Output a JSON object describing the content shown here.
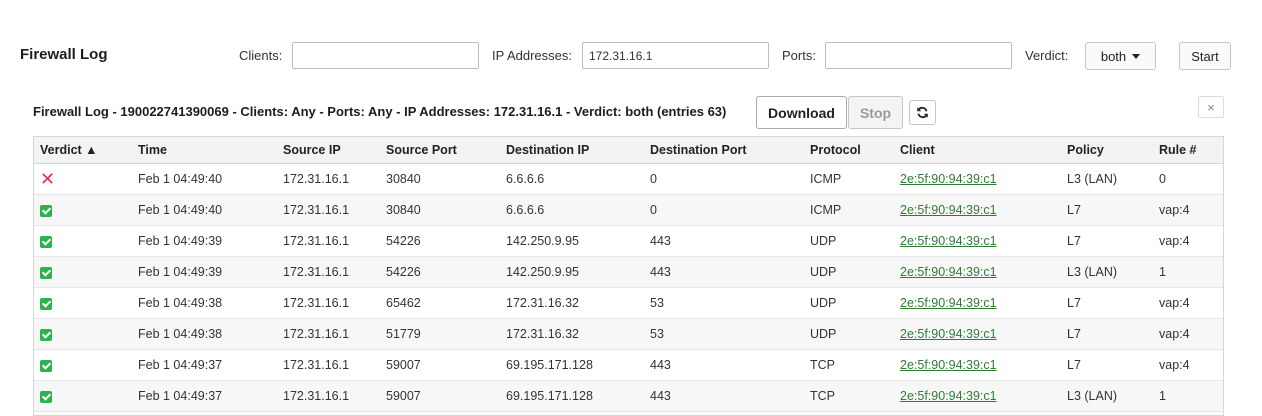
{
  "header": {
    "title": "Firewall Log"
  },
  "filters": {
    "clients_label": "Clients:",
    "clients_value": "",
    "ip_label": "IP Addresses:",
    "ip_value": "172.31.16.1",
    "ports_label": "Ports:",
    "ports_value": "",
    "verdict_label": "Verdict:",
    "verdict_value": "both",
    "start_label": "Start"
  },
  "toolbar": {
    "summary": "Firewall Log - 190022741390069 - Clients: Any - Ports: Any - IP Addresses: 172.31.16.1 - Verdict: both (entries 63)",
    "download_label": "Download",
    "stop_label": "Stop",
    "refresh_icon": "refresh-icon",
    "close_label": "×"
  },
  "table": {
    "columns": [
      "Verdict ▲",
      "Time",
      "Source IP",
      "Source Port",
      "Destination IP",
      "Destination Port",
      "Protocol",
      "Client",
      "Policy",
      "Rule #"
    ],
    "rows": [
      {
        "verdict": "deny",
        "time": "Feb 1 04:49:40",
        "src_ip": "172.31.16.1",
        "src_port": "30840",
        "dst_ip": "6.6.6.6",
        "dst_port": "0",
        "protocol": "ICMP",
        "client": "2e:5f:90:94:39:c1",
        "policy": "L3 (LAN)",
        "rule": "0"
      },
      {
        "verdict": "allow",
        "time": "Feb 1 04:49:40",
        "src_ip": "172.31.16.1",
        "src_port": "30840",
        "dst_ip": "6.6.6.6",
        "dst_port": "0",
        "protocol": "ICMP",
        "client": "2e:5f:90:94:39:c1",
        "policy": "L7",
        "rule": "vap:4"
      },
      {
        "verdict": "allow",
        "time": "Feb 1 04:49:39",
        "src_ip": "172.31.16.1",
        "src_port": "54226",
        "dst_ip": "142.250.9.95",
        "dst_port": "443",
        "protocol": "UDP",
        "client": "2e:5f:90:94:39:c1",
        "policy": "L7",
        "rule": "vap:4"
      },
      {
        "verdict": "allow",
        "time": "Feb 1 04:49:39",
        "src_ip": "172.31.16.1",
        "src_port": "54226",
        "dst_ip": "142.250.9.95",
        "dst_port": "443",
        "protocol": "UDP",
        "client": "2e:5f:90:94:39:c1",
        "policy": "L3 (LAN)",
        "rule": "1"
      },
      {
        "verdict": "allow",
        "time": "Feb 1 04:49:38",
        "src_ip": "172.31.16.1",
        "src_port": "65462",
        "dst_ip": "172.31.16.32",
        "dst_port": "53",
        "protocol": "UDP",
        "client": "2e:5f:90:94:39:c1",
        "policy": "L7",
        "rule": "vap:4"
      },
      {
        "verdict": "allow",
        "time": "Feb 1 04:49:38",
        "src_ip": "172.31.16.1",
        "src_port": "51779",
        "dst_ip": "172.31.16.32",
        "dst_port": "53",
        "protocol": "UDP",
        "client": "2e:5f:90:94:39:c1",
        "policy": "L7",
        "rule": "vap:4"
      },
      {
        "verdict": "allow",
        "time": "Feb 1 04:49:37",
        "src_ip": "172.31.16.1",
        "src_port": "59007",
        "dst_ip": "69.195.171.128",
        "dst_port": "443",
        "protocol": "TCP",
        "client": "2e:5f:90:94:39:c1",
        "policy": "L7",
        "rule": "vap:4"
      },
      {
        "verdict": "allow",
        "time": "Feb 1 04:49:37",
        "src_ip": "172.31.16.1",
        "src_port": "59007",
        "dst_ip": "69.195.171.128",
        "dst_port": "443",
        "protocol": "TCP",
        "client": "2e:5f:90:94:39:c1",
        "policy": "L3 (LAN)",
        "rule": "1"
      }
    ]
  },
  "colors": {
    "allow": "#2bb24c",
    "deny": "#e8304f",
    "link": "#2e7d32"
  }
}
